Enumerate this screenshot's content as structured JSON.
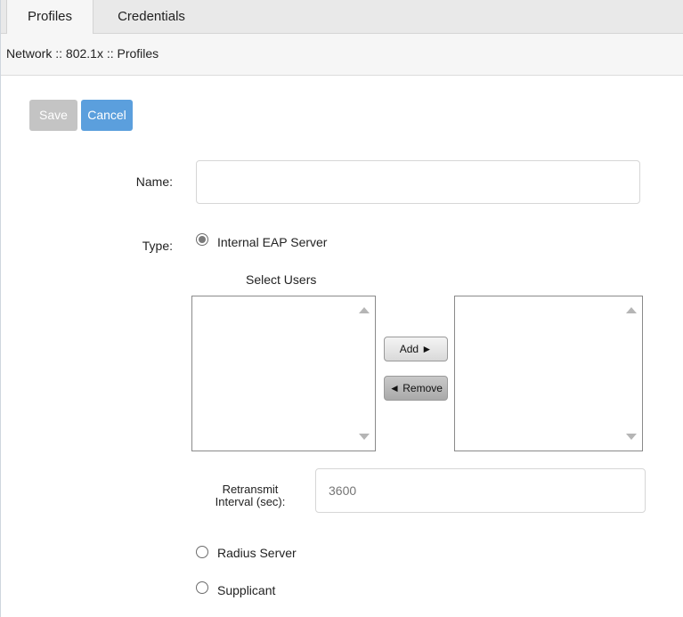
{
  "tabs": [
    {
      "label": "Profiles",
      "active": true
    },
    {
      "label": "Credentials",
      "active": false
    }
  ],
  "breadcrumb": "Network :: 802.1x :: Profiles",
  "toolbar": {
    "save_label": "Save",
    "cancel_label": "Cancel"
  },
  "form": {
    "name_label": "Name:",
    "name_value": "",
    "type_label": "Type:",
    "type_options": [
      {
        "label": "Internal EAP Server",
        "selected": true
      },
      {
        "label": "Radius Server",
        "selected": false
      },
      {
        "label": "Supplicant",
        "selected": false
      }
    ],
    "select_users_label": "Select Users",
    "add_label": "Add ►",
    "remove_label": "◄ Remove",
    "retransmit_label_line1": "Retransmit",
    "retransmit_label_line2": "Interval (sec):",
    "retransmit_placeholder": "3600"
  },
  "colors": {
    "primary_button": "#5b9fdd",
    "disabled_button": "#c4c4c4"
  }
}
